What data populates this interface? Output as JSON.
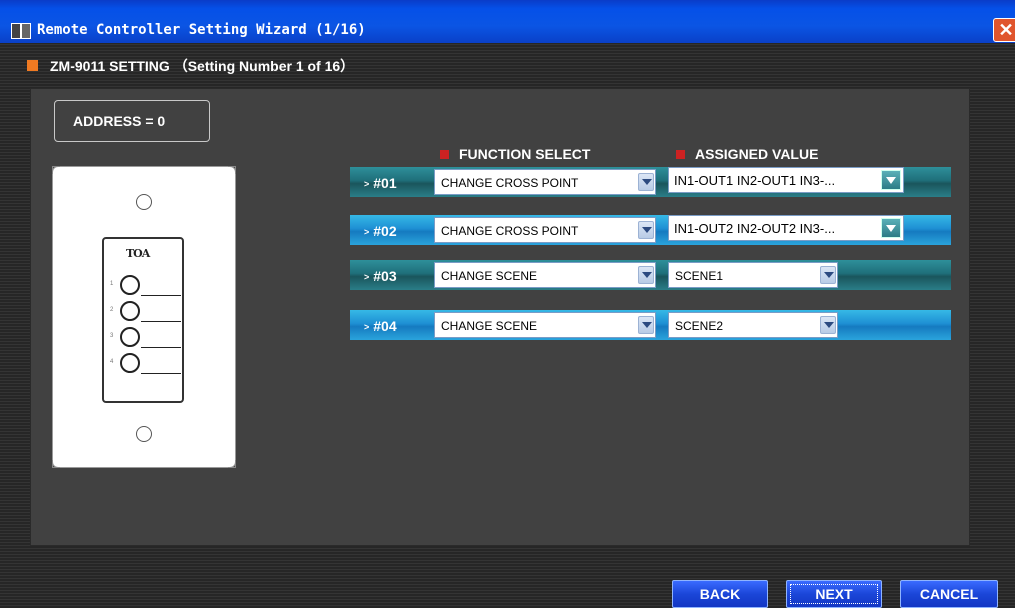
{
  "window": {
    "title": "Remote Controller Setting Wizard (1/16)",
    "close_glyph": "✕"
  },
  "header": {
    "setting_title": "ZM-9011 SETTING （Setting Number 1 of 16）"
  },
  "address": {
    "label": "ADDRESS = 0"
  },
  "device": {
    "logo": "TOA",
    "button_numbers": [
      "1",
      "2",
      "3",
      "4"
    ]
  },
  "columns": {
    "function": "FUNCTION SELECT",
    "assigned": "ASSIGNED VALUE"
  },
  "rows": [
    {
      "num": "#01",
      "function": "CHANGE CROSS POINT",
      "assigned": "IN1-OUT1 IN2-OUT1 IN3-...",
      "assigned_type": "text-button"
    },
    {
      "num": "#02",
      "function": "CHANGE CROSS POINT",
      "assigned": "IN1-OUT2 IN2-OUT2 IN3-...",
      "assigned_type": "text-button"
    },
    {
      "num": "#03",
      "function": "CHANGE SCENE",
      "assigned": "SCENE1",
      "assigned_type": "select"
    },
    {
      "num": "#04",
      "function": "CHANGE SCENE",
      "assigned": "SCENE2",
      "assigned_type": "select"
    }
  ],
  "buttons": {
    "back": "BACK",
    "next": "NEXT",
    "cancel": "CANCEL"
  },
  "colors": {
    "accent_orange": "#f07a22",
    "marker_red": "#cc2222",
    "row_teal": "#1f6f7a",
    "row_blue": "#1e90d4",
    "button_blue": "#1b46d8"
  },
  "icons": {
    "app": "toa-app-icon",
    "close": "close-icon"
  }
}
